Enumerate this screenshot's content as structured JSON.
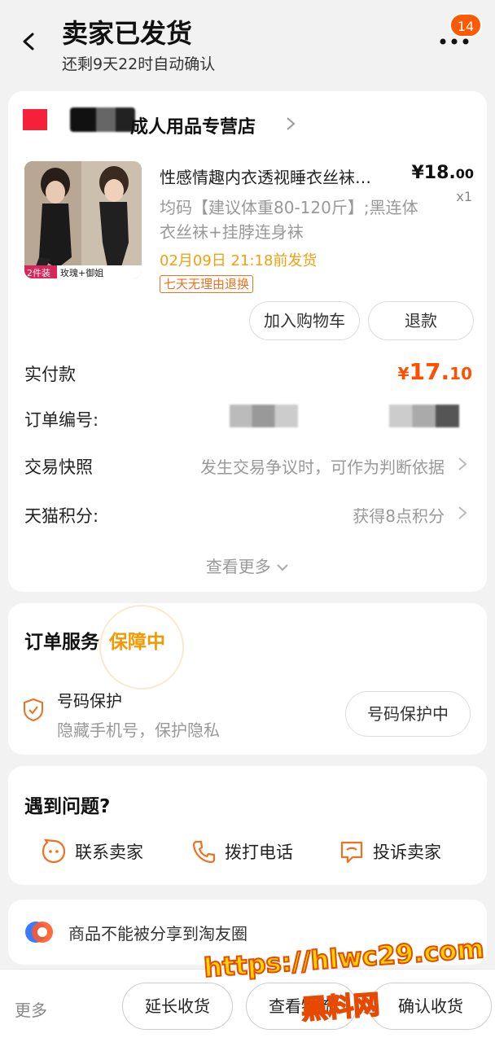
{
  "header": {
    "title": "卖家已发货",
    "subtitle": "还剩9天22时自动确认",
    "badge_count": "14"
  },
  "store": {
    "name": "成人用品专营店"
  },
  "product": {
    "title": "性感情趣内衣透视睡衣丝袜…",
    "price_int": "¥18.",
    "price_dec": "00",
    "qty": "x1",
    "sku": "均码【建议体重80-120斤】;黑连体衣丝袜+挂脖连身袜",
    "ship_by": "02月09日 21:18前发货",
    "tag": "七天无理由退换",
    "img_label_left": "2件装",
    "img_label_right": "玫瑰+御姐"
  },
  "buttons": {
    "add_cart": "加入购物车",
    "refund": "退款"
  },
  "rows": {
    "paid_label": "实付款",
    "paid_cur": "¥",
    "paid_int": "17.",
    "paid_dec": "10",
    "order_no_label": "订单编号:",
    "snapshot_label": "交易快照",
    "snapshot_value": "发生交易争议时，可作为判断依据",
    "points_label": "天猫积分:",
    "points_value": "获得8点积分",
    "see_more": "查看更多"
  },
  "service": {
    "title": "订单服务",
    "guard": "保障中",
    "item_name": "号码保护",
    "item_desc": "隐藏手机号，保护隐私",
    "item_button": "号码保护中"
  },
  "problems": {
    "title": "遇到问题?",
    "actions": [
      "联系卖家",
      "拨打电话",
      "投诉卖家"
    ]
  },
  "share": {
    "text": "商品不能被分享到淘友圈"
  },
  "bottom": {
    "more": "更多",
    "extend": "延长收货",
    "view": "查看物流",
    "confirm": "确认收货"
  },
  "watermark": {
    "line1": "https://hlwc29.com",
    "line2": "黑料网"
  },
  "colors": {
    "accent": "#ff5000",
    "guard": "#f39800",
    "store_logo": "#f5213b"
  }
}
